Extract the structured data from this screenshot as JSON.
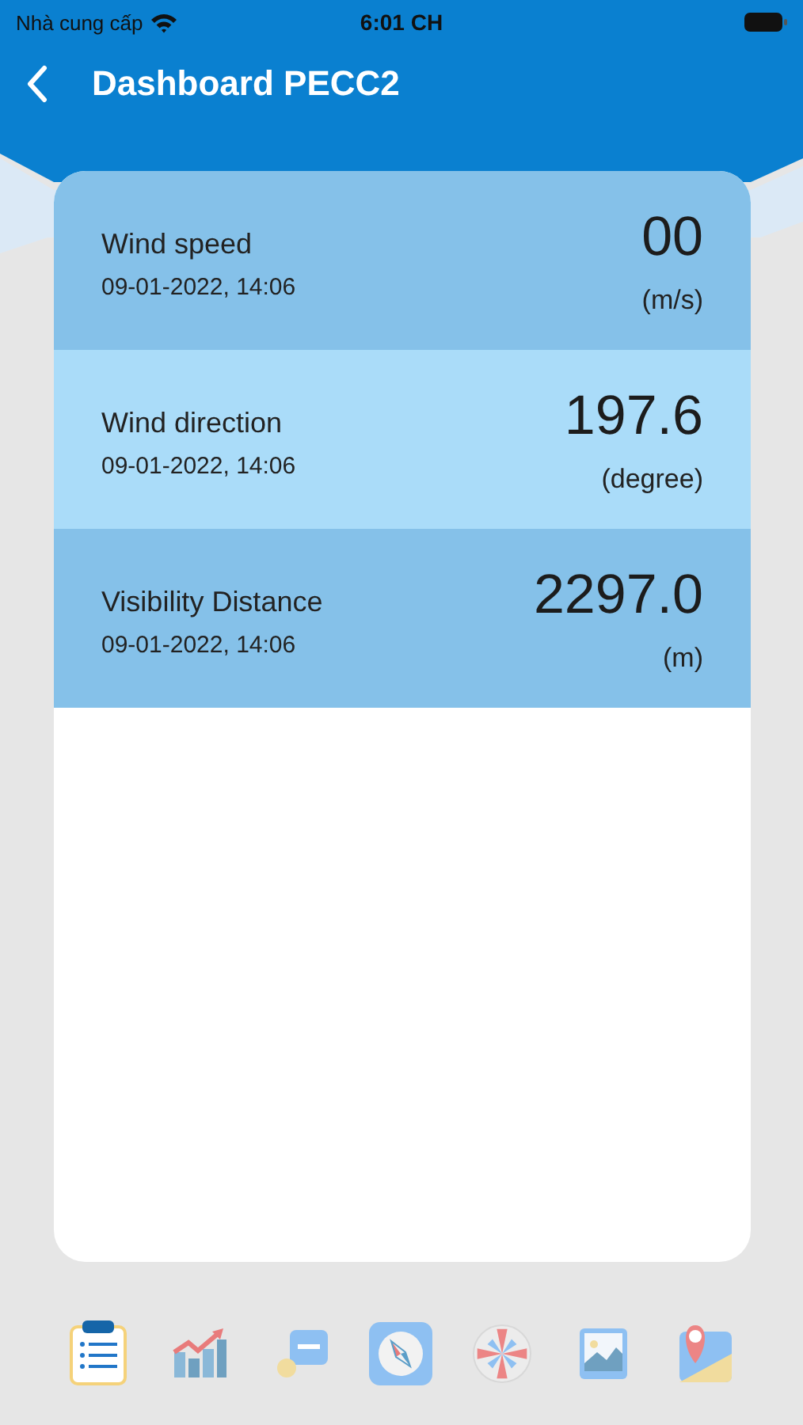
{
  "status_bar": {
    "carrier": "Nhà cung cấp",
    "time": "6:01 CH"
  },
  "header": {
    "title": "Dashboard PECC2"
  },
  "readings": [
    {
      "label": "Wind speed",
      "time": "09-01-2022, 14:06",
      "value": "00",
      "unit": "(m/s)",
      "color": "#85c1e9"
    },
    {
      "label": "Wind direction",
      "time": "09-01-2022, 14:06",
      "value": "197.6",
      "unit": "(degree)",
      "color": "#aadcf9"
    },
    {
      "label": "Visibility Distance",
      "time": "09-01-2022, 14:06",
      "value": "2297.0",
      "unit": "(m)",
      "color": "#85c1e9"
    }
  ],
  "nav": [
    {
      "kind": "list"
    },
    {
      "kind": "chart"
    },
    {
      "kind": "value"
    },
    {
      "kind": "compass"
    },
    {
      "kind": "rose"
    },
    {
      "kind": "image"
    },
    {
      "kind": "map"
    }
  ]
}
